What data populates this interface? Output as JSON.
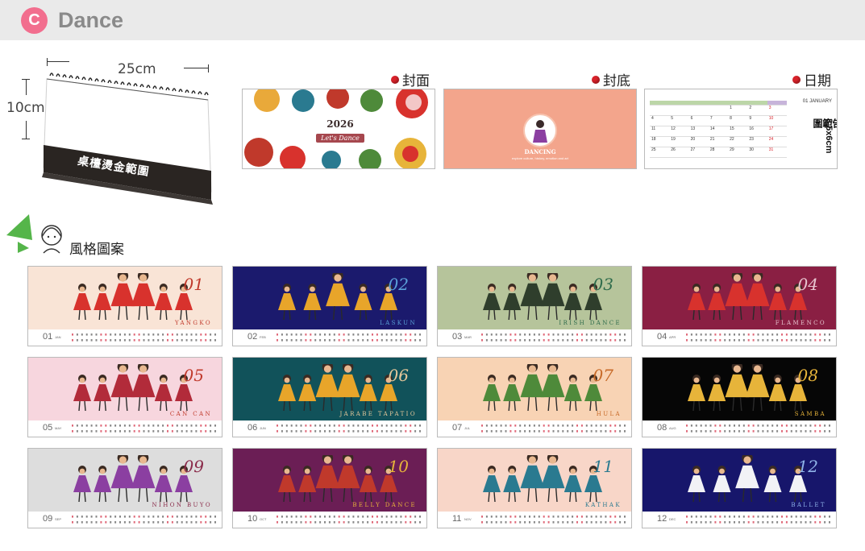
{
  "header": {
    "badge": "C",
    "title": "Dance"
  },
  "stand": {
    "width_label": "25cm",
    "height_label": "10cm",
    "base_label": "桌檯燙金範圍"
  },
  "sections": {
    "cover": "封面",
    "back": "封底",
    "date": "日期"
  },
  "cover_panel": {
    "year": "2026",
    "tag": "Let's Dance"
  },
  "back_panel": {
    "title": "DANCING",
    "subtitle": "explore culture, history, emotion and art"
  },
  "date_panel": {
    "corner": "01 JANUARY",
    "ad_size": "3.5x6cm",
    "ad_text": "廣告範圍",
    "rows": [
      [
        "",
        "",
        "",
        "",
        "1",
        "2",
        "3"
      ],
      [
        "4",
        "5",
        "6",
        "7",
        "8",
        "9",
        "10"
      ],
      [
        "11",
        "12",
        "13",
        "14",
        "15",
        "16",
        "17"
      ],
      [
        "18",
        "19",
        "20",
        "21",
        "22",
        "23",
        "24"
      ],
      [
        "25",
        "26",
        "27",
        "28",
        "29",
        "30",
        "31"
      ]
    ]
  },
  "style_label": "風格圖案",
  "months": [
    {
      "num": "01",
      "abbr": "JAN",
      "dance": "YANGKO",
      "bg": "#f9e4d6",
      "accent": "#c0392b",
      "dress": "#d8322d",
      "count": 6
    },
    {
      "num": "02",
      "abbr": "FEB",
      "dance": "LASKUN",
      "bg": "#1b1a6d",
      "accent": "#5aa0d8",
      "dress": "#e8a52a",
      "count": 5
    },
    {
      "num": "03",
      "abbr": "MAR",
      "dance": "IRISH DANCE",
      "bg": "#b6c49b",
      "accent": "#2e6b4b",
      "dress": "#2f3e2c",
      "count": 6
    },
    {
      "num": "04",
      "abbr": "APR",
      "dance": "FLAMENCO",
      "bg": "#8a1f43",
      "accent": "#e7c4cf",
      "dress": "#d8322d",
      "count": 6
    },
    {
      "num": "05",
      "abbr": "MAY",
      "dance": "CAN CAN",
      "bg": "#f7d6de",
      "accent": "#c0392b",
      "dress": "#b22b3a",
      "count": 6
    },
    {
      "num": "06",
      "abbr": "JUN",
      "dance": "JARABE TAPATIO",
      "bg": "#11525a",
      "accent": "#e5c79a",
      "dress": "#e8a52a",
      "count": 6
    },
    {
      "num": "07",
      "abbr": "JUL",
      "dance": "HULA",
      "bg": "#f8d3b4",
      "accent": "#c76a28",
      "dress": "#4e8a3a",
      "count": 6
    },
    {
      "num": "08",
      "abbr": "AUG",
      "dance": "SAMBA",
      "bg": "#060606",
      "accent": "#e7b43a",
      "dress": "#e7b43a",
      "count": 6
    },
    {
      "num": "09",
      "abbr": "SEP",
      "dance": "NIHON BUYO",
      "bg": "#dddddd",
      "accent": "#8a2b4a",
      "dress": "#8b3fa1",
      "count": 6
    },
    {
      "num": "10",
      "abbr": "OCT",
      "dance": "BELLY DANCE",
      "bg": "#6b1e55",
      "accent": "#e7b43a",
      "dress": "#c0392b",
      "count": 6
    },
    {
      "num": "11",
      "abbr": "NOV",
      "dance": "KATHAK",
      "bg": "#f8d6c8",
      "accent": "#2a7a90",
      "dress": "#2a7a90",
      "count": 6
    },
    {
      "num": "12",
      "abbr": "DEC",
      "dance": "BALLET",
      "bg": "#17166b",
      "accent": "#8fb3e8",
      "dress": "#f2f2f6",
      "count": 5
    }
  ]
}
